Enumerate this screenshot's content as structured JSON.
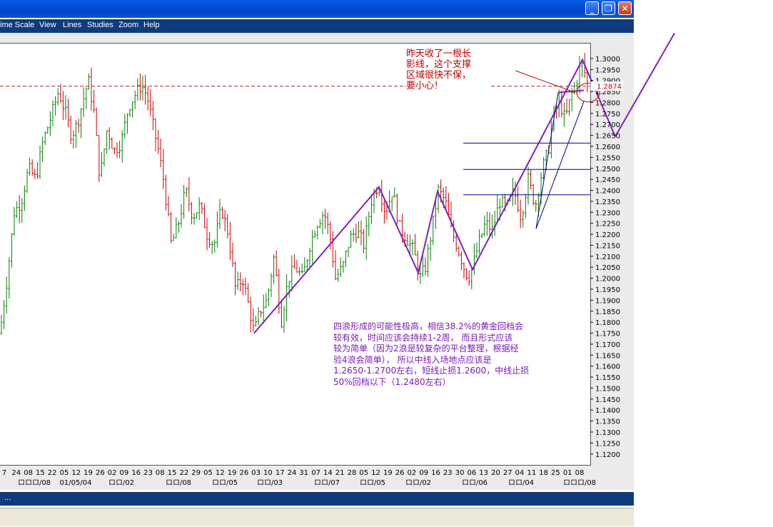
{
  "window": {
    "buttons": {
      "minimize": "_",
      "maximize": "❐",
      "close": "✕"
    }
  },
  "menu": {
    "items": [
      {
        "id": "timescale",
        "label": "ime Scale"
      },
      {
        "id": "view",
        "label": "View"
      },
      {
        "id": "lines",
        "label": "Lines"
      },
      {
        "id": "studies",
        "label": "Studies"
      },
      {
        "id": "zoom",
        "label": "Zoom"
      },
      {
        "id": "help",
        "label": "Help"
      }
    ]
  },
  "status": {
    "text": "..."
  },
  "annotations": {
    "red_note": "昨天收了一根长\n影线，这个支撑\n区域很快不保，\n要小心！",
    "purple_note": "四浪形成的可能性极高，相信38.2%的黄金回档会\n较有效，时间应该会持续1-2周， 而且形式应该\n较为简单（因为2浪是较复杂的平台整理，根据经\n验4浪会简单）， 所以中线入场地点应该是\n1.2650-1.2700左右，短线止损1.2600，中线止损\n50%回档以下（1.2480左右）"
  },
  "colors": {
    "bars": [
      "#cc0000",
      "#008000"
    ],
    "wave_lines": "#7f1fbf",
    "fib_lines": "#00008b",
    "dashed_level": "#b22222",
    "axis_text": "#000000"
  },
  "chart_data": {
    "type": "ohlc-bar",
    "y_ticks": [
      "1.3000",
      "1.2950",
      "1.2900",
      "1.2850",
      "1.2800",
      "1.2750",
      "1.2700",
      "1.2650",
      "1.2600",
      "1.2550",
      "1.2500",
      "1.2450",
      "1.2400",
      "1.2350",
      "1.2300",
      "1.2250",
      "1.2200",
      "1.2150",
      "1.2100",
      "1.2050",
      "1.2000",
      "1.1950",
      "1.1900",
      "1.1850",
      "1.1800",
      "1.1750",
      "1.1700",
      "1.1650",
      "1.1600",
      "1.1550",
      "1.1500",
      "1.1450",
      "1.1400",
      "1.1350",
      "1.1300",
      "1.1250",
      "1.1200"
    ],
    "ylim": [
      1.117,
      1.3055
    ],
    "highlight_level": "1.2874",
    "highlight_value": 1.2874,
    "fib_levels": [
      1.2615,
      1.2495,
      1.238
    ],
    "x_day_labels": [
      "7",
      "24",
      "08",
      "15",
      "22",
      "05",
      "12",
      "19",
      "26",
      "02",
      "09",
      "16",
      "23",
      "08",
      "15",
      "22",
      "29",
      "05",
      "12",
      "19",
      "26",
      "03",
      "10",
      "17",
      "24",
      "31",
      "07",
      "14",
      "21",
      "28",
      "05",
      "12",
      "19",
      "26",
      "02",
      "09",
      "16",
      "23",
      "30",
      "06",
      "13",
      "20",
      "27",
      "04",
      "11",
      "18",
      "25",
      "01",
      "08"
    ],
    "x_period_labels": [
      "ロロロ/08",
      "01/05/04",
      "ロロ/02",
      "ロロ/08",
      "ロロ/05",
      "ロロ/03",
      "ロロ/07",
      "ロロ/05",
      "ロロ/02",
      "ロロ/06",
      "ロロ/04",
      "ロロロ/08"
    ],
    "close_path": [
      [
        0,
        1.175
      ],
      [
        10,
        1.2
      ],
      [
        20,
        1.23
      ],
      [
        30,
        1.235
      ],
      [
        40,
        1.25
      ],
      [
        50,
        1.245
      ],
      [
        60,
        1.262
      ],
      [
        70,
        1.272
      ],
      [
        82,
        1.285
      ],
      [
        92,
        1.275
      ],
      [
        100,
        1.265
      ],
      [
        108,
        1.27
      ],
      [
        118,
        1.283
      ],
      [
        124,
        1.29
      ],
      [
        132,
        1.275
      ],
      [
        140,
        1.245
      ],
      [
        150,
        1.268
      ],
      [
        160,
        1.258
      ],
      [
        170,
        1.262
      ],
      [
        180,
        1.278
      ],
      [
        190,
        1.284
      ],
      [
        198,
        1.288
      ],
      [
        206,
        1.283
      ],
      [
        214,
        1.27
      ],
      [
        222,
        1.258
      ],
      [
        230,
        1.243
      ],
      [
        240,
        1.215
      ],
      [
        250,
        1.225
      ],
      [
        260,
        1.24
      ],
      [
        270,
        1.228
      ],
      [
        280,
        1.233
      ],
      [
        290,
        1.22
      ],
      [
        300,
        1.215
      ],
      [
        310,
        1.232
      ],
      [
        320,
        1.22
      ],
      [
        330,
        1.195
      ],
      [
        340,
        1.2
      ],
      [
        350,
        1.185
      ],
      [
        356,
        1.175
      ],
      [
        364,
        1.185
      ],
      [
        374,
        1.19
      ],
      [
        384,
        1.21
      ],
      [
        394,
        1.18
      ],
      [
        404,
        1.2
      ],
      [
        414,
        1.205
      ],
      [
        424,
        1.2
      ],
      [
        434,
        1.215
      ],
      [
        444,
        1.225
      ],
      [
        454,
        1.23
      ],
      [
        462,
        1.22
      ],
      [
        470,
        1.2
      ],
      [
        480,
        1.205
      ],
      [
        490,
        1.218
      ],
      [
        500,
        1.222
      ],
      [
        510,
        1.215
      ],
      [
        520,
        1.235
      ],
      [
        530,
        1.243
      ],
      [
        540,
        1.23
      ],
      [
        550,
        1.24
      ],
      [
        560,
        1.223
      ],
      [
        570,
        1.218
      ],
      [
        580,
        1.212
      ],
      [
        588,
        1.2
      ],
      [
        596,
        1.205
      ],
      [
        604,
        1.22
      ],
      [
        614,
        1.24
      ],
      [
        624,
        1.235
      ],
      [
        632,
        1.222
      ],
      [
        640,
        1.215
      ],
      [
        650,
        1.205
      ],
      [
        656,
        1.2
      ],
      [
        662,
        1.205
      ],
      [
        670,
        1.215
      ],
      [
        680,
        1.225
      ],
      [
        690,
        1.222
      ],
      [
        700,
        1.235
      ],
      [
        710,
        1.232
      ],
      [
        720,
        1.24
      ],
      [
        730,
        1.228
      ],
      [
        740,
        1.245
      ],
      [
        750,
        1.233
      ],
      [
        760,
        1.25
      ],
      [
        768,
        1.258
      ],
      [
        776,
        1.275
      ],
      [
        784,
        1.28
      ],
      [
        792,
        1.272
      ],
      [
        800,
        1.283
      ],
      [
        808,
        1.29
      ],
      [
        814,
        1.298
      ],
      [
        820,
        1.293
      ],
      [
        826,
        1.285
      ]
    ],
    "wave_lines": [
      {
        "points": [
          [
            356,
            1.175
          ],
          [
            531,
            1.2415
          ],
          [
            586,
            1.2025
          ],
          [
            613,
            1.2395
          ],
          [
            662,
            1.204
          ],
          [
            816,
            1.2995
          ],
          [
            862,
            1.2645
          ]
        ]
      },
      {
        "points": [
          [
            862,
            1.2645
          ],
          [
            945,
            1.3115
          ]
        ]
      },
      {
        "points": [
          [
            782,
            1.2845
          ],
          [
            818,
            1.2855
          ]
        ]
      }
    ],
    "channel_lines": [
      {
        "points": [
          [
            751,
            1.2225
          ],
          [
            818,
            1.2805
          ]
        ]
      },
      {
        "points": [
          [
            782,
            1.2845
          ],
          [
            751,
            1.2225
          ]
        ]
      }
    ],
    "arrow": {
      "points": [
        [
          722,
          1.2945
        ],
        [
          806,
          1.2845
        ]
      ]
    }
  }
}
